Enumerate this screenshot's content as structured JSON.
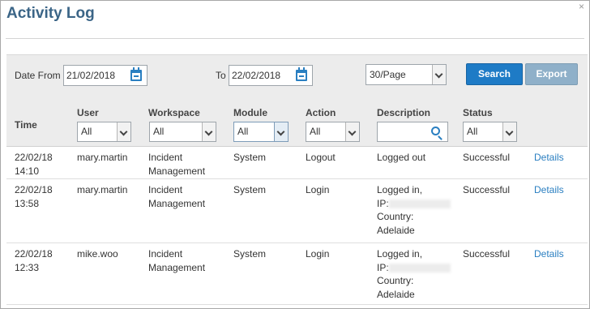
{
  "dialog": {
    "title": "Activity Log",
    "close_symbol": "×"
  },
  "toolbar": {
    "date_from_label": "Date From",
    "date_from_value": "21/02/2018",
    "to_label": "To",
    "to_value": "22/02/2018",
    "page_size_value": "30/Page",
    "search_label": "Search",
    "export_label": "Export"
  },
  "columns": {
    "time": "Time",
    "user": "User",
    "workspace": "Workspace",
    "module": "Module",
    "action": "Action",
    "description": "Description",
    "status": "Status"
  },
  "filters": {
    "user": "All",
    "workspace": "All",
    "module": "All",
    "action": "All",
    "status": "All",
    "description": ""
  },
  "rows": [
    {
      "date": "22/02/18",
      "time": "14:10",
      "user": "mary.martin",
      "workspace_line1": "Incident",
      "workspace_line2": "Management",
      "module": "System",
      "action": "Logout",
      "desc_line1": "Logged out",
      "status": "Successful",
      "details": "Details"
    },
    {
      "date": "22/02/18",
      "time": "13:58",
      "user": "mary.martin",
      "workspace_line1": "Incident",
      "workspace_line2": "Management",
      "module": "System",
      "action": "Login",
      "desc_line1": "Logged in,",
      "ip_label": "IP:",
      "country_label": "Country:",
      "country_value": "Adelaide",
      "status": "Successful",
      "details": "Details"
    },
    {
      "date": "22/02/18",
      "time": "12:33",
      "user": "mike.woo",
      "workspace_line1": "Incident",
      "workspace_line2": "Management",
      "module": "System",
      "action": "Login",
      "desc_line1": "Logged in,",
      "ip_label": "IP:",
      "country_label": "Country:",
      "country_value": "Adelaide",
      "status": "Successful",
      "details": "Details"
    }
  ],
  "colors": {
    "title": "#3b6587",
    "link": "#2a7fc1",
    "search_button": "#1e7bc6",
    "export_button": "#8fb0c9",
    "toolbar_bg": "#ececec"
  }
}
